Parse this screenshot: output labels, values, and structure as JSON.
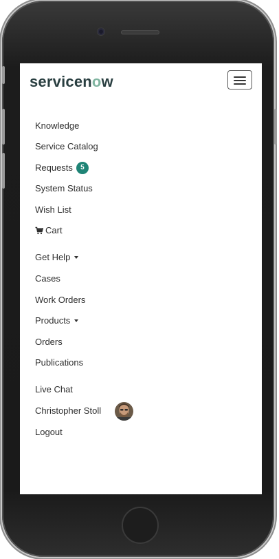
{
  "header": {
    "logo_prefix": "servicen",
    "logo_o": "o",
    "logo_suffix": "w",
    "menu_toggle_icon": "hamburger-icon"
  },
  "nav": {
    "knowledge": "Knowledge",
    "service_catalog": "Service Catalog",
    "requests": "Requests",
    "requests_badge": "5",
    "system_status": "System Status",
    "wish_list": "Wish List",
    "cart": "Cart",
    "cart_icon": "cart-icon",
    "get_help": "Get Help",
    "cases": "Cases",
    "work_orders": "Work Orders",
    "products": "Products",
    "orders": "Orders",
    "publications": "Publications",
    "live_chat": "Live Chat",
    "user_name": "Christopher Stoll",
    "logout": "Logout"
  },
  "colors": {
    "brand_text": "#293e40",
    "badge_bg": "#1f8476",
    "logo_accent": "#81b5a1"
  }
}
